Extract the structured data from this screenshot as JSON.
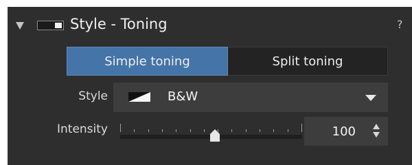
{
  "panel": {
    "title": "Style - Toning",
    "help_label": "?",
    "enabled": true
  },
  "tabs": [
    {
      "label": "Simple toning",
      "active": true
    },
    {
      "label": "Split toning",
      "active": false
    }
  ],
  "style": {
    "label": "Style",
    "selected_value": "B&W",
    "swatch_icon": "bw-diagonal-swatch-icon"
  },
  "intensity": {
    "label": "Intensity",
    "value": "100",
    "slider_min": 0,
    "slider_max": 200,
    "slider_value": 100
  },
  "colors": {
    "panel_bg": "#2e2e2e",
    "active_tab": "#4474a8",
    "field_bg": "#3d3d3d"
  }
}
